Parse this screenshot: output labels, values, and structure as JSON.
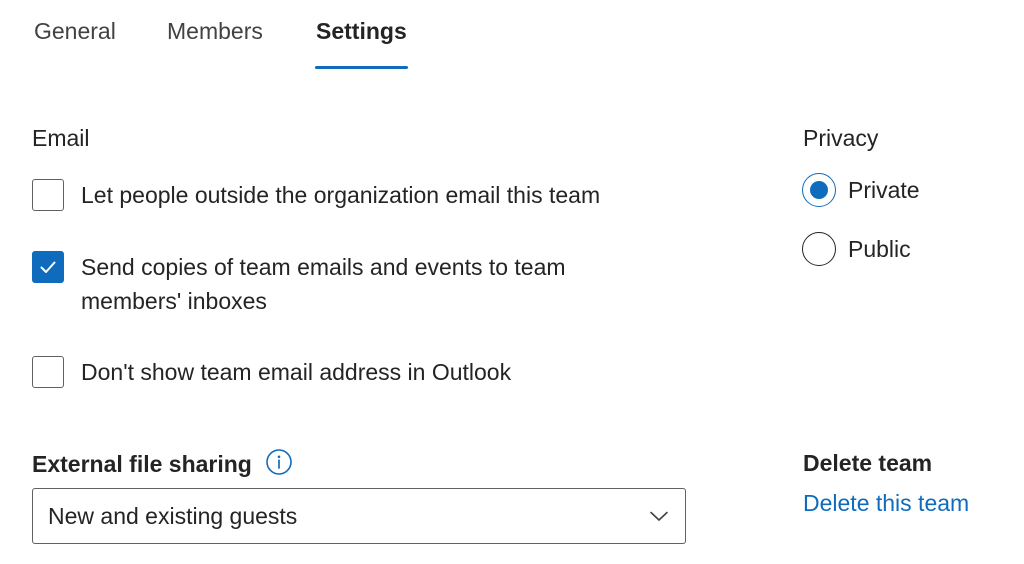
{
  "tabs": [
    {
      "label": "General",
      "active": false
    },
    {
      "label": "Members",
      "active": false
    },
    {
      "label": "Settings",
      "active": true
    }
  ],
  "email": {
    "heading": "Email",
    "options": [
      {
        "label": "Let people outside the organization email this team",
        "checked": false
      },
      {
        "label": "Send copies of team emails and events to team members' inboxes",
        "checked": true
      },
      {
        "label": "Don't show team email address in Outlook",
        "checked": false
      }
    ]
  },
  "privacy": {
    "heading": "Privacy",
    "options": [
      {
        "label": "Private",
        "selected": true
      },
      {
        "label": "Public",
        "selected": false
      }
    ]
  },
  "external_file_sharing": {
    "heading": "External file sharing",
    "info_icon": "info-icon",
    "selected_value": "New and existing guests"
  },
  "delete_team": {
    "heading": "Delete team",
    "link_label": "Delete this team"
  },
  "colors": {
    "accent": "#0f6cbd",
    "text": "#242424",
    "border": "#616161"
  }
}
